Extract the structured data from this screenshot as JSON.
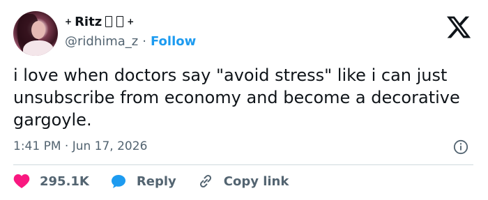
{
  "user": {
    "display_name": "Ritz",
    "handle": "@ridhima_z",
    "separator": "·",
    "follow_label": "Follow",
    "sparkle": "+"
  },
  "brand": {
    "logo_icon": "x-logo-icon"
  },
  "tweet": {
    "text": "i love when doctors say \"avoid stress\" like i can just unsubscribe from economy and become a decorative gargoyle.",
    "timestamp": "1:41 PM · Jun 17, 2026"
  },
  "actions": {
    "like_count": "295.1K",
    "reply_label": "Reply",
    "copy_link_label": "Copy link"
  },
  "colors": {
    "accent_blue": "#1d9bf0",
    "like_red": "#f91880",
    "muted_text": "#536471",
    "divider": "#cfd9de"
  }
}
